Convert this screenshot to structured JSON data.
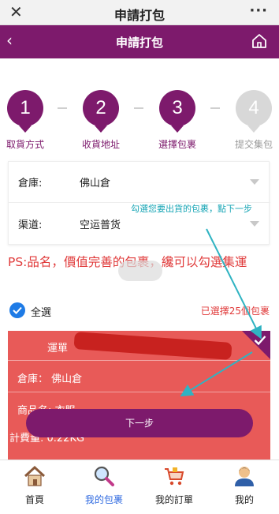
{
  "wechat": {
    "title": "申請打包",
    "close_icon": "close-icon",
    "more_icon": "more-icon"
  },
  "header": {
    "title": "申請打包",
    "back_icon": "back-icon",
    "home_icon": "home-icon"
  },
  "steps": [
    {
      "number": "1",
      "label": "取貨方式",
      "state": "active"
    },
    {
      "number": "2",
      "label": "收貨地址",
      "state": "active"
    },
    {
      "number": "3",
      "label": "選擇包裹",
      "state": "active"
    },
    {
      "number": "4",
      "label": "提交集包",
      "state": "inactive"
    }
  ],
  "selectors": {
    "warehouse": {
      "label": "倉庫:",
      "value": "佛山倉"
    },
    "channel": {
      "label": "渠道:",
      "value": "空运普货"
    }
  },
  "hint": "勾選您要出貨的包裹，點下一步",
  "notice": "PS:品名，價值完善的包裹，纔可以勾選集運",
  "select_all": {
    "label": "全選",
    "checked": true
  },
  "selected_count": "已選擇25個包裹",
  "parcel": {
    "tracking_label": "運單",
    "warehouse": "倉庫： 佛山倉",
    "product": "商品名: 衣服",
    "weight": "計費量: 0.22KG",
    "selected": true
  },
  "next_button": "下一步",
  "tabs": [
    {
      "label": "首頁",
      "icon": "home-icon",
      "active": false
    },
    {
      "label": "我的包裹",
      "icon": "magnifier-icon",
      "active": true
    },
    {
      "label": "我的訂單",
      "icon": "cart-icon",
      "active": false
    },
    {
      "label": "我的",
      "icon": "user-icon",
      "active": false
    }
  ],
  "colors": {
    "brand": "#7d1a6c",
    "card": "#e85a58",
    "notice": "#e03a3a",
    "hint": "#17a5b5",
    "active_tab": "#2f6ae0"
  }
}
